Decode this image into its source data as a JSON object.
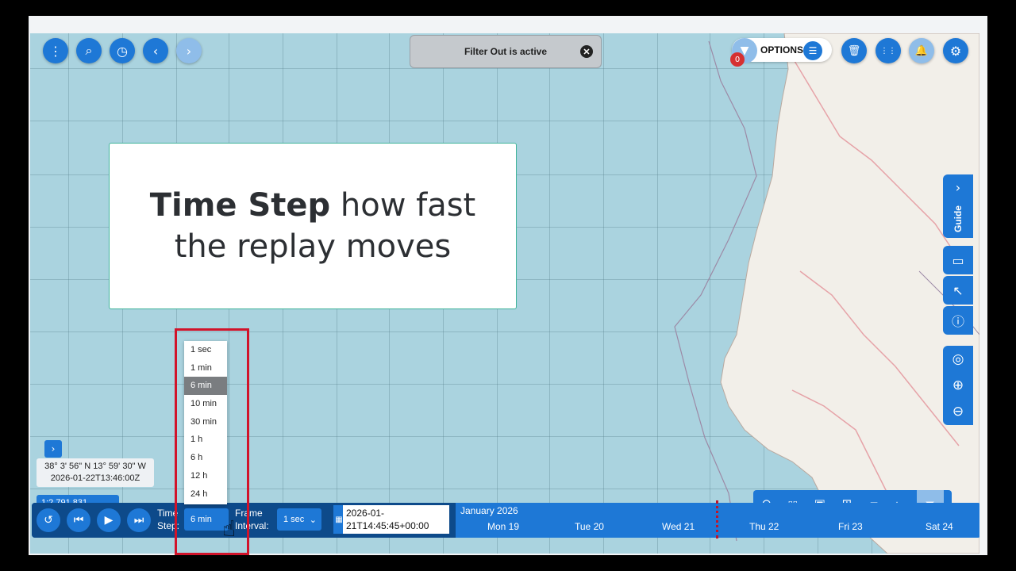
{
  "top_left_buttons": [
    {
      "name": "menu-icon",
      "glyph": "⋮"
    },
    {
      "name": "search-icon",
      "glyph": "⌕"
    },
    {
      "name": "clock-icon",
      "glyph": "◷"
    },
    {
      "name": "chevron-left-icon",
      "glyph": "‹"
    },
    {
      "name": "chevron-right-icon",
      "glyph": "›"
    }
  ],
  "filter_banner": {
    "text": "Filter Out is active",
    "close_glyph": "✕"
  },
  "options": {
    "label": "OPTIONS",
    "filter_count": "0",
    "funnel_glyph": "▼",
    "list_glyph": "☰"
  },
  "top_right_buttons": [
    {
      "name": "trash-icon",
      "glyph": "🗑"
    },
    {
      "name": "grid-apps-icon",
      "glyph": "⋮⋮"
    },
    {
      "name": "bell-icon",
      "glyph": "🔔"
    },
    {
      "name": "gear-icon",
      "glyph": "⚙"
    }
  ],
  "callout": {
    "bold": "Time Step",
    "rest_line1": " how fast",
    "line2": "the replay moves"
  },
  "guide_tab": {
    "label": "Guide",
    "chevron": "›"
  },
  "side_tools": [
    {
      "name": "ruler-icon",
      "glyph": "▭"
    },
    {
      "name": "pointer-icon",
      "glyph": "↖"
    },
    {
      "name": "info-icon",
      "glyph": "ⓘ"
    },
    {
      "name": "locate-icon",
      "glyph": "◎"
    },
    {
      "name": "zoom-in-icon",
      "glyph": "⊕"
    },
    {
      "name": "zoom-out-icon",
      "glyph": "⊖"
    }
  ],
  "coordinates": {
    "position": "38° 3' 56\" N 13° 59' 30\" W",
    "datetime": "2026-01-22T13:46:00Z",
    "expand": "›"
  },
  "scale": {
    "value": "1:2,791,831",
    "chevron": "⌄"
  },
  "map_toolbar": [
    {
      "name": "replay-icon",
      "glyph": "⊙"
    },
    {
      "name": "book-icon",
      "glyph": "▯▯"
    },
    {
      "name": "image-icon",
      "glyph": "▣"
    },
    {
      "name": "grid-icon",
      "glyph": "⊞"
    },
    {
      "name": "folder-icon",
      "glyph": "▰"
    },
    {
      "name": "caret-up-icon",
      "glyph": "▴"
    },
    {
      "name": "filter-icon",
      "glyph": "⏷"
    }
  ],
  "replay": {
    "time_step_label": "Time Step:",
    "time_step_value": "6 min",
    "frame_interval_label": "Frame Interval:",
    "frame_interval_value": "1 sec",
    "datetime_value": "2026-01-21T14:45:45+00:00",
    "month": "January 2026",
    "days": [
      "Mon 19",
      "Tue 20",
      "Wed 21",
      "Thu 22",
      "Fri 23",
      "Sat 24"
    ]
  },
  "time_step_options": [
    "1 sec",
    "1 min",
    "6 min",
    "10 min",
    "30 min",
    "1 h",
    "6 h",
    "12 h",
    "24 h"
  ],
  "selected_time_step": "6 min",
  "colors": {
    "primary": "#1e78d6",
    "dark": "#0d4a8a",
    "highlight": "#d1132a",
    "sea": "#aad3df",
    "callout_border": "#3fb39a"
  }
}
